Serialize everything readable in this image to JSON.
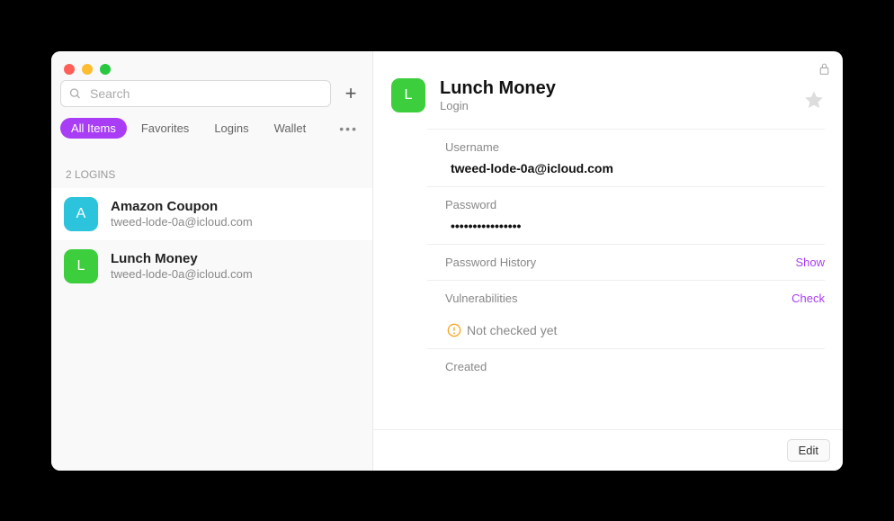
{
  "search": {
    "placeholder": "Search"
  },
  "filters": {
    "all": "All Items",
    "favorites": "Favorites",
    "logins": "Logins",
    "wallet": "Wallet"
  },
  "listHeader": "2 LOGINS",
  "items": [
    {
      "initial": "A",
      "title": "Amazon Coupon",
      "sub": "tweed-lode-0a@icloud.com",
      "color": "blue"
    },
    {
      "initial": "L",
      "title": "Lunch Money",
      "sub": "tweed-lode-0a@icloud.com",
      "color": "green"
    }
  ],
  "detail": {
    "initial": "L",
    "title": "Lunch Money",
    "subtitle": "Login",
    "usernameLabel": "Username",
    "usernameValue": "tweed-lode-0a@icloud.com",
    "passwordLabel": "Password",
    "passwordValue": "••••••••••••••••",
    "passwordHistoryLabel": "Password History",
    "showLabel": "Show",
    "vulnLabel": "Vulnerabilities",
    "checkLabel": "Check",
    "vulnStatus": "Not checked yet",
    "createdLabel": "Created",
    "editLabel": "Edit"
  }
}
